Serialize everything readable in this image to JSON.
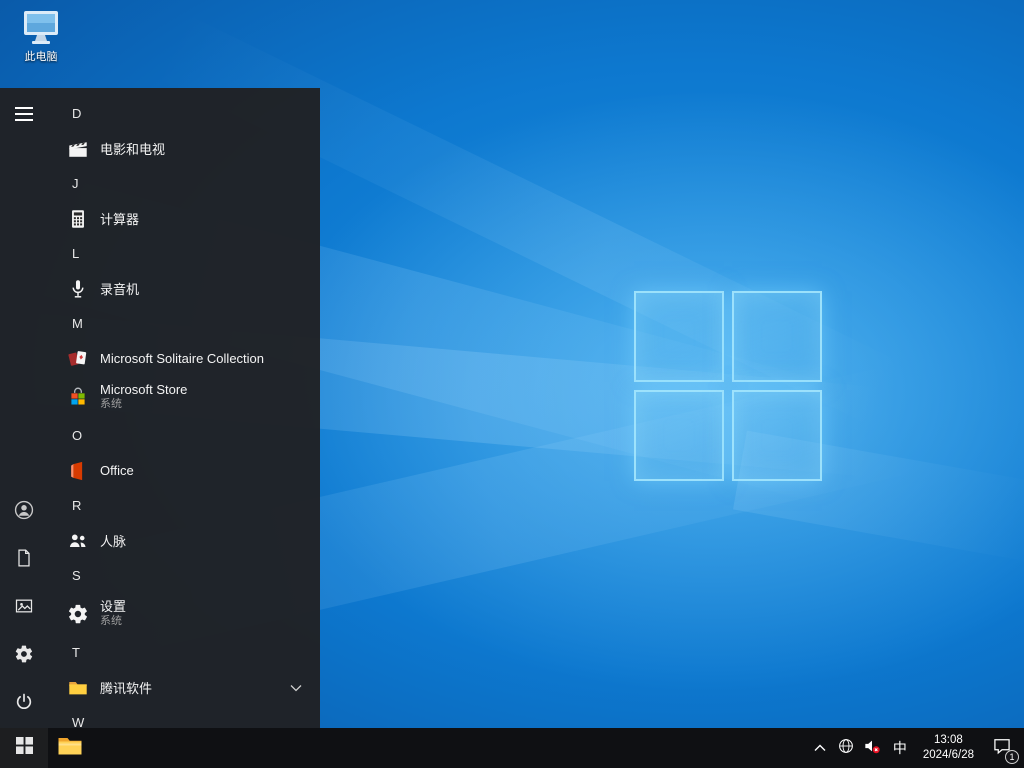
{
  "desktop": {
    "this_pc_label": "此电脑"
  },
  "start_menu": {
    "letters": [
      "D",
      "J",
      "L",
      "M",
      "O",
      "R",
      "S",
      "T",
      "W"
    ],
    "apps": {
      "movies": {
        "label": "电影和电视"
      },
      "calculator": {
        "label": "计算器"
      },
      "recorder": {
        "label": "录音机"
      },
      "solitaire": {
        "label": "Microsoft Solitaire Collection"
      },
      "store": {
        "label": "Microsoft Store",
        "sublabel": "系统"
      },
      "office": {
        "label": "Office"
      },
      "people": {
        "label": "人脉"
      },
      "settings": {
        "label": "设置",
        "sublabel": "系统"
      },
      "tencent": {
        "label": "腾讯软件"
      }
    },
    "rail_icons": [
      "hamburger-icon",
      "user-icon",
      "document-icon",
      "picture-icon",
      "gear-icon",
      "power-icon"
    ]
  },
  "taskbar": {
    "ime": "中",
    "time": "13:08",
    "date": "2024/6/28",
    "notification_count": "1",
    "tray_icons": [
      "chevron-up-icon",
      "network-globe-icon",
      "speaker-muted-icon",
      "action-center-icon"
    ]
  },
  "colors": {
    "wallpaper_blue": "#0d78cf",
    "logo_glow": "#87d7ff",
    "menu_bg": "#202124",
    "taskbar_bg": "#0f1013",
    "folder_yellow": "#ffd257",
    "office_orange": "#d83b01",
    "store_red": "#f25022",
    "store_green": "#7fba00",
    "store_blue": "#00a4ef",
    "store_yellow": "#ffb900",
    "mute_red": "#e81123"
  }
}
